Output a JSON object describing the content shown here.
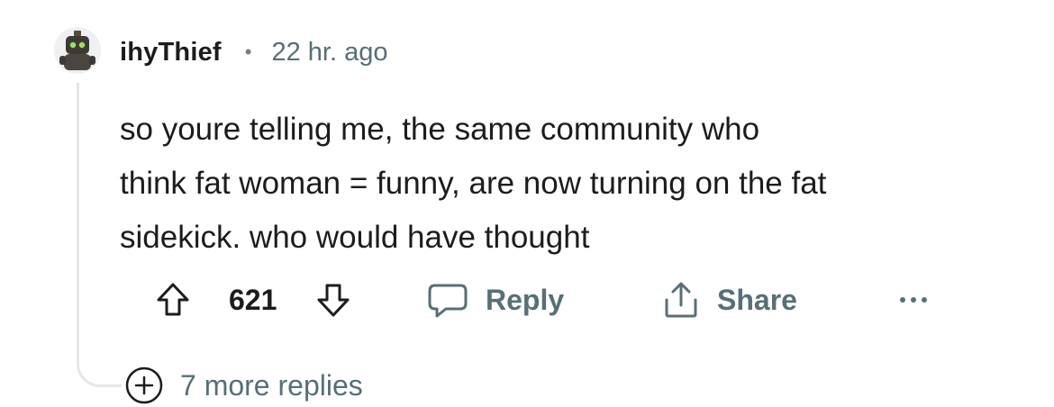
{
  "comment": {
    "username": "ihyThief",
    "separator": "•",
    "time": "22 hr. ago",
    "avatar": "robot-avatar",
    "body_lines": [
      "so youre telling me, the same community who",
      "think fat woman = funny, are now turning on the fat",
      "sidekick. who would have thought"
    ],
    "score": "621",
    "reply_label": "Reply",
    "share_label": "Share",
    "more_label": "•••",
    "more_replies_label": "7 more replies"
  },
  "icons": {
    "upvote": "upvote-arrow-icon",
    "downvote": "downvote-arrow-icon",
    "reply": "speech-bubble-icon",
    "share": "share-icon",
    "overflow": "more-dots-icon",
    "expand": "plus-circle-icon"
  },
  "colors": {
    "text": "#1c1c1c",
    "meta": "#576f76",
    "thread_line": "#e4e6e8"
  }
}
